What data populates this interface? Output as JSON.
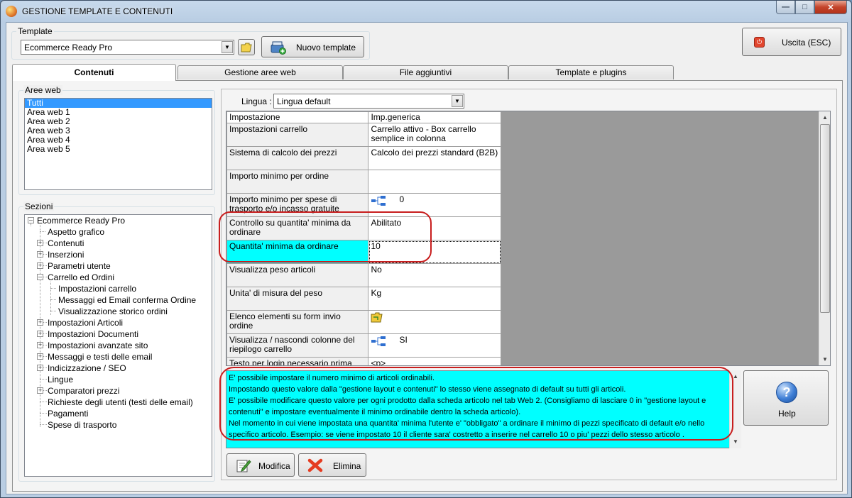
{
  "window": {
    "title": "GESTIONE TEMPLATE E CONTENUTI"
  },
  "template_group": {
    "legend": "Template",
    "selected": "Ecommerce Ready Pro",
    "new_button": "Nuovo template"
  },
  "exit_button": "Uscita (ESC)",
  "tabs": [
    {
      "label": "Contenuti",
      "active": true
    },
    {
      "label": "Gestione aree web"
    },
    {
      "label": "File aggiuntivi"
    },
    {
      "label": "Template e plugins"
    }
  ],
  "aree_web": {
    "legend": "Aree web",
    "items": [
      "Tutti",
      "Area web 1",
      "Area web 2",
      "Area web 3",
      "Area web 4",
      "Area web 5"
    ]
  },
  "sezioni": {
    "legend": "Sezioni",
    "nodes": [
      {
        "label": "Ecommerce Ready Pro"
      },
      {
        "label": "Aspetto grafico"
      },
      {
        "label": "Contenuti"
      },
      {
        "label": "Inserzioni"
      },
      {
        "label": "Parametri utente"
      },
      {
        "label": "Carrello ed Ordini"
      },
      {
        "label": "Impostazioni carrello"
      },
      {
        "label": "Messaggi ed Email conferma Ordine"
      },
      {
        "label": "Visualizzazione storico ordini"
      },
      {
        "label": "Impostazioni Articoli"
      },
      {
        "label": "Impostazioni Documenti"
      },
      {
        "label": "Impostazioni avanzate sito"
      },
      {
        "label": "Messaggi e testi delle email"
      },
      {
        "label": "Indicizzazione / SEO"
      },
      {
        "label": "Lingue"
      },
      {
        "label": "Comparatori prezzi"
      },
      {
        "label": "Richieste degli utenti (testi delle email)"
      },
      {
        "label": "Pagamenti"
      },
      {
        "label": "Spese di trasporto"
      }
    ]
  },
  "lingua": {
    "label": "Lingua :",
    "selected": "Lingua default"
  },
  "grid": {
    "headers": [
      "Impostazione",
      "Imp.generica"
    ],
    "rows": [
      {
        "name": "Impostazioni carrello",
        "value": "Carrello attivo - Box carrello semplice in colonna"
      },
      {
        "name": "Sistema di calcolo dei prezzi",
        "value": "Calcolo dei prezzi standard (B2B)"
      },
      {
        "name": "Importo minimo per ordine",
        "value": ""
      },
      {
        "name": "Importo minimo per spese di trasporto e/o incasso gratuite",
        "value": "0",
        "icon": "tree-icon"
      },
      {
        "name": "Controllo su quantita' minima da ordinare",
        "value": "Abilitato"
      },
      {
        "name": "Quantita' minima da ordinare",
        "value": "10",
        "selected": true
      },
      {
        "name": "Visualizza peso articoli",
        "value": "No"
      },
      {
        "name": "Unita' di misura del peso",
        "value": "Kg"
      },
      {
        "name": "Elenco elementi su form invio ordine",
        "value": "",
        "icon": "folder-icon"
      },
      {
        "name": "Visualizza / nascondi colonne del riepilogo carrello",
        "value": "SI",
        "icon": "tree-icon"
      },
      {
        "name": "Testo per login necessario prima",
        "value": "<p>"
      }
    ]
  },
  "description": {
    "lines": [
      "E' possibile impostare il numero minimo di articoli ordinabili.",
      "Impostando questo valore dalla \"gestione layout e contenuti\" lo stesso viene assegnato di default su tutti gli articoli.",
      "E' possibile modificare questo valore per ogni prodotto dalla scheda articolo nel tab Web 2. (Consigliamo di lasciare 0 in \"gestione layout e contenuti\" e impostare eventualmente il minimo ordinabile dentro la scheda articolo).",
      "Nel momento in cui viene impostata una quantita' minima l'utente e' \"obbligato\" a ordinare il minimo di pezzi specificato di default e/o nello specifico articolo. Esempio: se viene impostato 10 il cliente sara' costretto a inserire nel carrello 10 o piu' pezzi dello stesso articolo ."
    ]
  },
  "buttons": {
    "help": "Help",
    "modifica": "Modifica",
    "elimina": "Elimina"
  }
}
